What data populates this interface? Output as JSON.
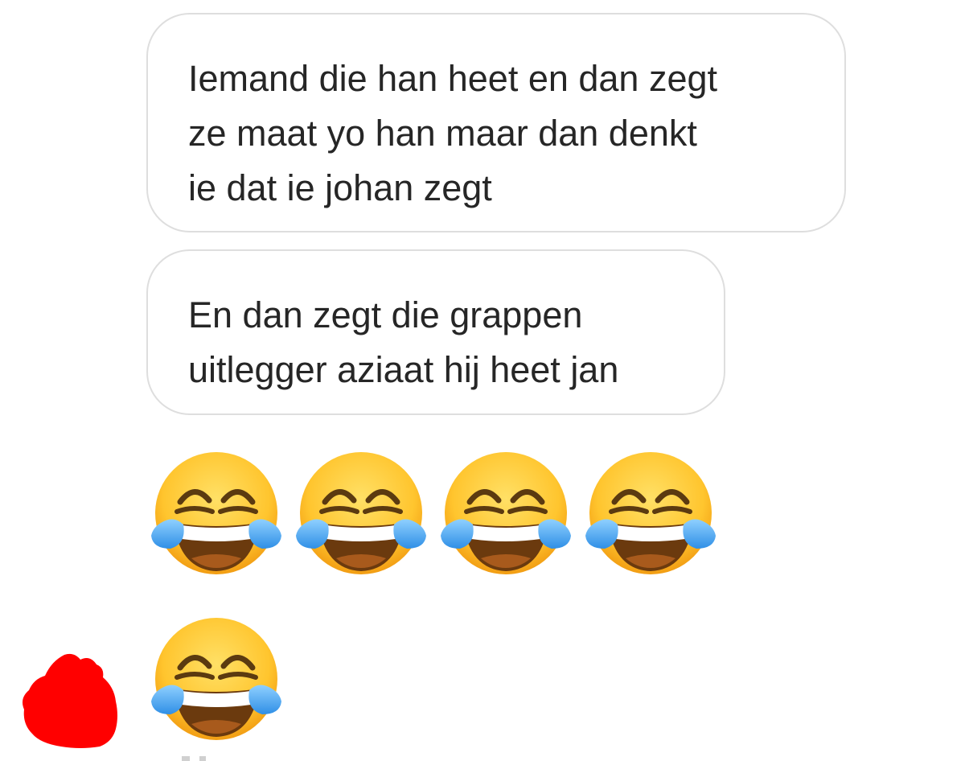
{
  "messages": [
    {
      "lines": [
        "Iemand die han heet en dan zegt",
        "ze maat yo han maar dan denkt",
        "ie dat ie johan zegt"
      ]
    },
    {
      "lines": [
        "En dan zegt die grappen",
        "uitlegger aziaat hij heet jan"
      ]
    }
  ],
  "emoji_messages": [
    {
      "emoji": "😂😂😂😂",
      "icons": [
        "face-with-tears-of-joy",
        "face-with-tears-of-joy",
        "face-with-tears-of-joy",
        "face-with-tears-of-joy"
      ]
    },
    {
      "emoji": "😂",
      "icons": [
        "face-with-tears-of-joy"
      ]
    }
  ],
  "colors": {
    "bubble_border": "#dedede",
    "text": "#262626",
    "redaction": "#ff0000",
    "emoji_face": "#ffc930",
    "tears": "#4fa9f0"
  }
}
